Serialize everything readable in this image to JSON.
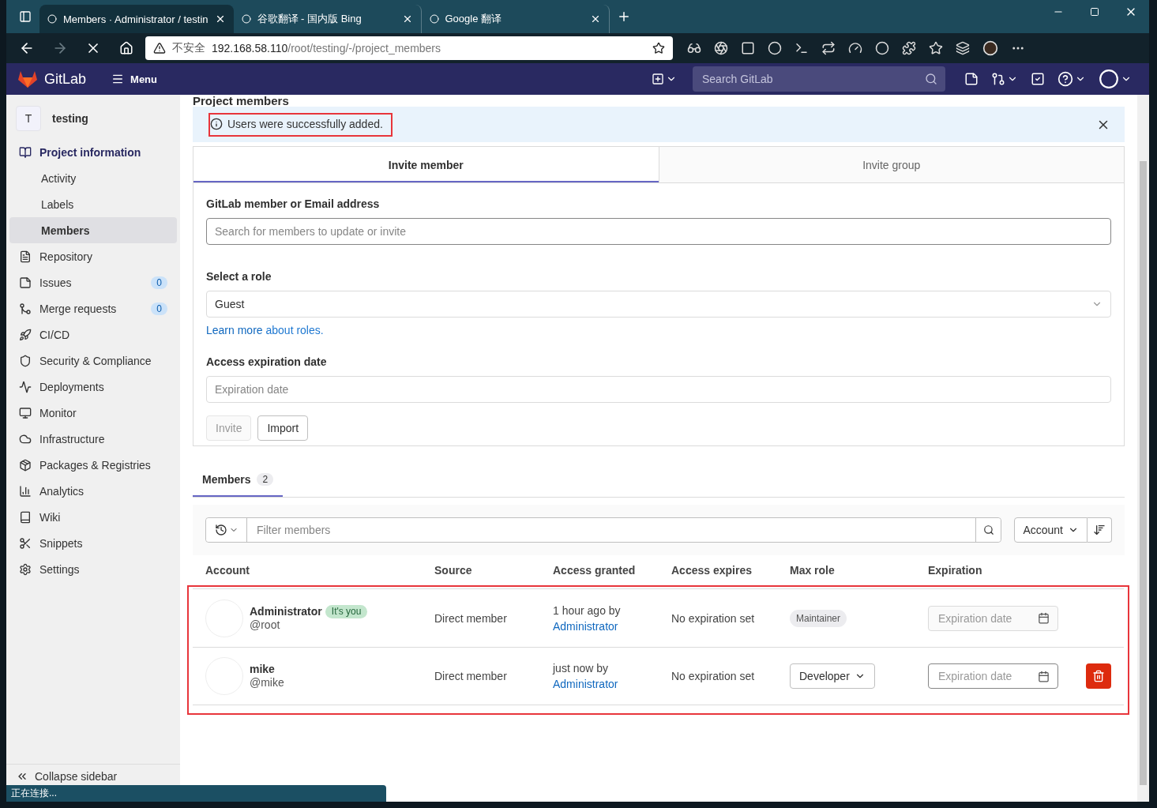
{
  "browser": {
    "tabs": [
      {
        "title": "Members · Administrator / testin",
        "selected": true
      },
      {
        "title": "谷歌翻译 - 国内版 Bing",
        "selected": false
      },
      {
        "title": "Google 翻译",
        "selected": false
      }
    ],
    "address": {
      "security": "不安全",
      "host": "192.168.58.110",
      "path": "/root/testing/-/project_members"
    },
    "status": "正在连接..."
  },
  "navbar": {
    "brand": "GitLab",
    "menu": "Menu",
    "search_placeholder": "Search GitLab"
  },
  "sidebar": {
    "project_initial": "T",
    "project_name": "testing",
    "items": [
      {
        "label": "Project information",
        "selected": false,
        "expanded": true,
        "children": [
          {
            "label": "Activity",
            "selected": false
          },
          {
            "label": "Labels",
            "selected": false
          },
          {
            "label": "Members",
            "selected": true
          }
        ]
      },
      {
        "label": "Repository",
        "selected": false
      },
      {
        "label": "Issues",
        "selected": false,
        "count": "0"
      },
      {
        "label": "Merge requests",
        "selected": false,
        "count": "0"
      },
      {
        "label": "CI/CD",
        "selected": false
      },
      {
        "label": "Security & Compliance",
        "selected": false
      },
      {
        "label": "Deployments",
        "selected": false
      },
      {
        "label": "Monitor",
        "selected": false
      },
      {
        "label": "Infrastructure",
        "selected": false
      },
      {
        "label": "Packages & Registries",
        "selected": false
      },
      {
        "label": "Analytics",
        "selected": false
      },
      {
        "label": "Wiki",
        "selected": false
      },
      {
        "label": "Snippets",
        "selected": false
      },
      {
        "label": "Settings",
        "selected": false
      }
    ],
    "collapse": "Collapse sidebar"
  },
  "page_title": "Project members",
  "alert": {
    "message": "Users were successfully added."
  },
  "invite_tabs": [
    {
      "label": "Invite member",
      "selected": true
    },
    {
      "label": "Invite group",
      "selected": false
    }
  ],
  "invite_form": {
    "member_label": "GitLab member or Email address",
    "member_placeholder": "Search for members to update or invite",
    "role_label": "Select a role",
    "role_value": "Guest",
    "learn_more_link": "Learn more",
    "learn_more_rest": "about roles.",
    "expiry_label": "Access expiration date",
    "expiry_placeholder": "Expiration date",
    "buttons": [
      {
        "label": "Invite",
        "disabled": true
      },
      {
        "label": "Import",
        "disabled": false
      }
    ]
  },
  "member_tabs": [
    {
      "label": "Members",
      "count": "2",
      "selected": true
    }
  ],
  "filter": {
    "placeholder": "Filter members",
    "sort": "Account"
  },
  "table": {
    "columns": [
      "Account",
      "Source",
      "Access granted",
      "Access expires",
      "Max role",
      "Expiration"
    ],
    "rows": [
      {
        "name": "Administrator",
        "badge": "It's you",
        "username": "@root",
        "source": "Direct member",
        "granted": "1 hour ago by",
        "granted_by": "Administrator",
        "expires": "No expiration set",
        "role": "Maintainer",
        "role_editable": false,
        "expiration_placeholder": "Expiration date",
        "expiration_disabled": true,
        "removable": false
      },
      {
        "name": "mike",
        "username": "@mike",
        "source": "Direct member",
        "granted": "just now by",
        "granted_by": "Administrator",
        "expires": "No expiration set",
        "role": "Developer",
        "role_editable": true,
        "expiration_placeholder": "Expiration date",
        "expiration_disabled": false,
        "removable": true
      }
    ]
  }
}
